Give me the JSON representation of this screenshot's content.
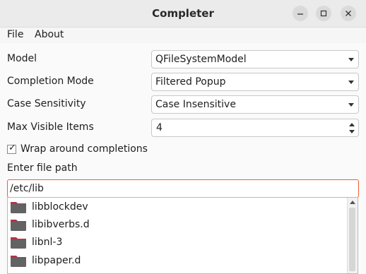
{
  "window": {
    "title": "Completer"
  },
  "menubar": {
    "items": [
      "File",
      "About"
    ]
  },
  "form": {
    "model": {
      "label": "Model",
      "value": "QFileSystemModel"
    },
    "completion_mode": {
      "label": "Completion Mode",
      "value": "Filtered Popup"
    },
    "case_sensitivity": {
      "label": "Case Sensitivity",
      "value": "Case Insensitive"
    },
    "max_visible_items": {
      "label": "Max Visible Items",
      "value": "4"
    },
    "wrap_around": {
      "label": "Wrap around completions",
      "checked": true
    },
    "file_path": {
      "label": "Enter file path",
      "value": "/etc/lib"
    }
  },
  "popup": {
    "items": [
      "libblockdev",
      "libibverbs.d",
      "libnl-3",
      "libpaper.d"
    ]
  },
  "colors": {
    "focus_border": "#e9632e",
    "folder_body": "#636363",
    "folder_tab": "#b2344a"
  }
}
